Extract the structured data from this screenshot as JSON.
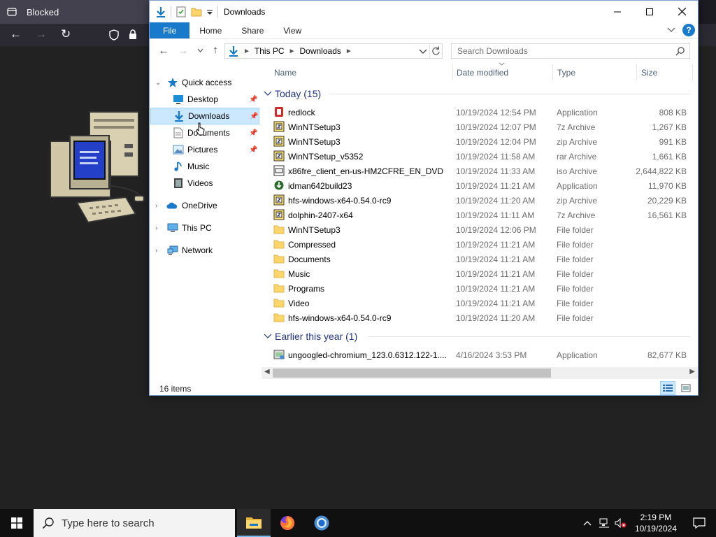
{
  "browser": {
    "tab_title": "Blocked",
    "icons": [
      "tab-overview-icon",
      "back-icon",
      "forward-icon",
      "reload-icon",
      "shield-icon",
      "lock-icon"
    ]
  },
  "window": {
    "title": "Downloads",
    "controls": [
      "minimize",
      "maximize",
      "close"
    ]
  },
  "ribbon": {
    "tabs": [
      "File",
      "Home",
      "Share",
      "View"
    ],
    "help": "?"
  },
  "address": {
    "segments": [
      "This PC",
      "Downloads"
    ],
    "search_placeholder": "Search Downloads"
  },
  "nav": {
    "quick_access": "Quick access",
    "desktop": "Desktop",
    "downloads": "Downloads",
    "documents": "Documents",
    "pictures": "Pictures",
    "music": "Music",
    "videos": "Videos",
    "onedrive": "OneDrive",
    "this_pc": "This PC",
    "network": "Network"
  },
  "columns": {
    "name": "Name",
    "date": "Date modified",
    "type": "Type",
    "size": "Size"
  },
  "groups": {
    "today": "Today (15)",
    "earlier": "Earlier this year (1)"
  },
  "files_today": [
    {
      "name": "redlock",
      "date": "10/19/2024 12:54 PM",
      "type": "Application",
      "size": "808 KB",
      "icon": "app-red"
    },
    {
      "name": "WinNTSetup3",
      "date": "10/19/2024 12:07 PM",
      "type": "7z Archive",
      "size": "1,267 KB",
      "icon": "archive"
    },
    {
      "name": "WinNTSetup3",
      "date": "10/19/2024 12:04 PM",
      "type": "zip Archive",
      "size": "991 KB",
      "icon": "archive"
    },
    {
      "name": "WinNTSetup_v5352",
      "date": "10/19/2024 11:58 AM",
      "type": "rar Archive",
      "size": "1,661 KB",
      "icon": "archive"
    },
    {
      "name": "x86fre_client_en-us-HM2CFRE_EN_DVD",
      "date": "10/19/2024 11:33 AM",
      "type": "iso Archive",
      "size": "2,644,822 KB",
      "icon": "iso"
    },
    {
      "name": "idman642build23",
      "date": "10/19/2024 11:21 AM",
      "type": "Application",
      "size": "11,970 KB",
      "icon": "app-idm"
    },
    {
      "name": "hfs-windows-x64-0.54.0-rc9",
      "date": "10/19/2024 11:20 AM",
      "type": "zip Archive",
      "size": "20,229 KB",
      "icon": "archive"
    },
    {
      "name": "dolphin-2407-x64",
      "date": "10/19/2024 11:11 AM",
      "type": "7z Archive",
      "size": "16,561 KB",
      "icon": "archive"
    },
    {
      "name": "WinNTSetup3",
      "date": "10/19/2024 12:06 PM",
      "type": "File folder",
      "size": "",
      "icon": "folder"
    },
    {
      "name": "Compressed",
      "date": "10/19/2024 11:21 AM",
      "type": "File folder",
      "size": "",
      "icon": "folder"
    },
    {
      "name": "Documents",
      "date": "10/19/2024 11:21 AM",
      "type": "File folder",
      "size": "",
      "icon": "folder"
    },
    {
      "name": "Music",
      "date": "10/19/2024 11:21 AM",
      "type": "File folder",
      "size": "",
      "icon": "folder"
    },
    {
      "name": "Programs",
      "date": "10/19/2024 11:21 AM",
      "type": "File folder",
      "size": "",
      "icon": "folder"
    },
    {
      "name": "Video",
      "date": "10/19/2024 11:21 AM",
      "type": "File folder",
      "size": "",
      "icon": "folder"
    },
    {
      "name": "hfs-windows-x64-0.54.0-rc9",
      "date": "10/19/2024 11:20 AM",
      "type": "File folder",
      "size": "",
      "icon": "folder"
    }
  ],
  "files_earlier": [
    {
      "name": "ungoogled-chromium_123.0.6312.122-1....",
      "date": "4/16/2024 3:53 PM",
      "type": "Application",
      "size": "82,677 KB",
      "icon": "app-installer"
    }
  ],
  "status": {
    "items": "16 items"
  },
  "taskbar": {
    "search_placeholder": "Type here to search",
    "time": "2:19 PM",
    "date": "10/19/2024"
  },
  "colors": {
    "accent": "#1979ca",
    "selection": "#cce8ff",
    "group_header": "#1e3287",
    "folder": "#ffd66b"
  }
}
